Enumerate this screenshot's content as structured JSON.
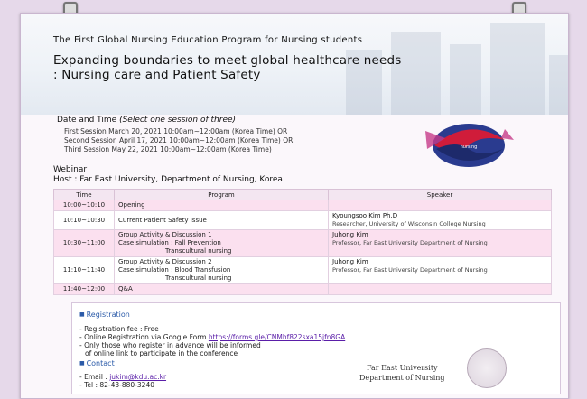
{
  "header": {
    "title_line1": "The First Global Nursing Education Program for Nursing students",
    "title_line2a": "Expanding boundaries to meet global healthcare needs",
    "title_line2b": ": Nursing care and Patient Safety"
  },
  "schedule": {
    "label": "Date and Time ",
    "note": "(Select one session of three)",
    "sessions": [
      "First Session March 20, 2021 10:00am~12:00am (Korea Time) OR",
      "Second Session April 17, 2021 10:00am~12:00am (Korea Time) OR",
      "Third Session May 22, 2021 10:00am~12:00am (Korea Time)"
    ]
  },
  "webinar": {
    "label": "Webinar",
    "host": "Host : Far East University, Department of Nursing, Korea"
  },
  "program": {
    "headers": [
      "Time",
      "Program",
      "Speaker"
    ],
    "rows": [
      {
        "time": "10:00~10:10",
        "program": [
          "Opening"
        ],
        "speaker_name": "",
        "speaker_aff": ""
      },
      {
        "time": "10:10~10:30",
        "program": [
          "Current Patient Safety Issue"
        ],
        "speaker_name": "Kyoungsoo Kim Ph.D",
        "speaker_aff": "Researcher, University of Wisconsin College Nursing"
      },
      {
        "time": "10:30~11:00",
        "program": [
          "Group Activity & Discussion 1",
          "Case simulation : Fall Prevention",
          "Transcultural nursing"
        ],
        "speaker_name": "Juhong Kim",
        "speaker_aff": "Professor, Far East University Department of Nursing"
      },
      {
        "time": "11:10~11:40",
        "program": [
          "Group Activity & Discussion 2",
          "Case simulation : Blood Transfusion",
          "Transcultural nursing"
        ],
        "speaker_name": "Juhong Kim",
        "speaker_aff": "Professor, Far East University Department of Nursing"
      },
      {
        "time": "11:40~12:00",
        "program": [
          "Q&A"
        ],
        "speaker_name": "",
        "speaker_aff": ""
      }
    ]
  },
  "registration": {
    "heading": "Registration",
    "fee": "- Registration fee : Free",
    "online_prefix": "- Online Registration via Google Form ",
    "online_link": "https://forms.gle/CNMhf822sxa15jfn8GA",
    "notice1": "- Only those who register in advance will be informed",
    "notice2": "of online link to participate in the conference"
  },
  "contact": {
    "heading": "Contact",
    "email_prefix": "- Email : ",
    "email": "jukim@kdu.ac.kr",
    "tel": "- Tel : 82-43-880-3240"
  },
  "signature": {
    "line1": "Far East University",
    "line2": "Department of Nursing"
  },
  "colors": {
    "background": "#e6d9ea",
    "table_pink": "#fbe0ef",
    "heading_blue": "#2a5aa8",
    "link_purple": "#5a1ea8"
  }
}
